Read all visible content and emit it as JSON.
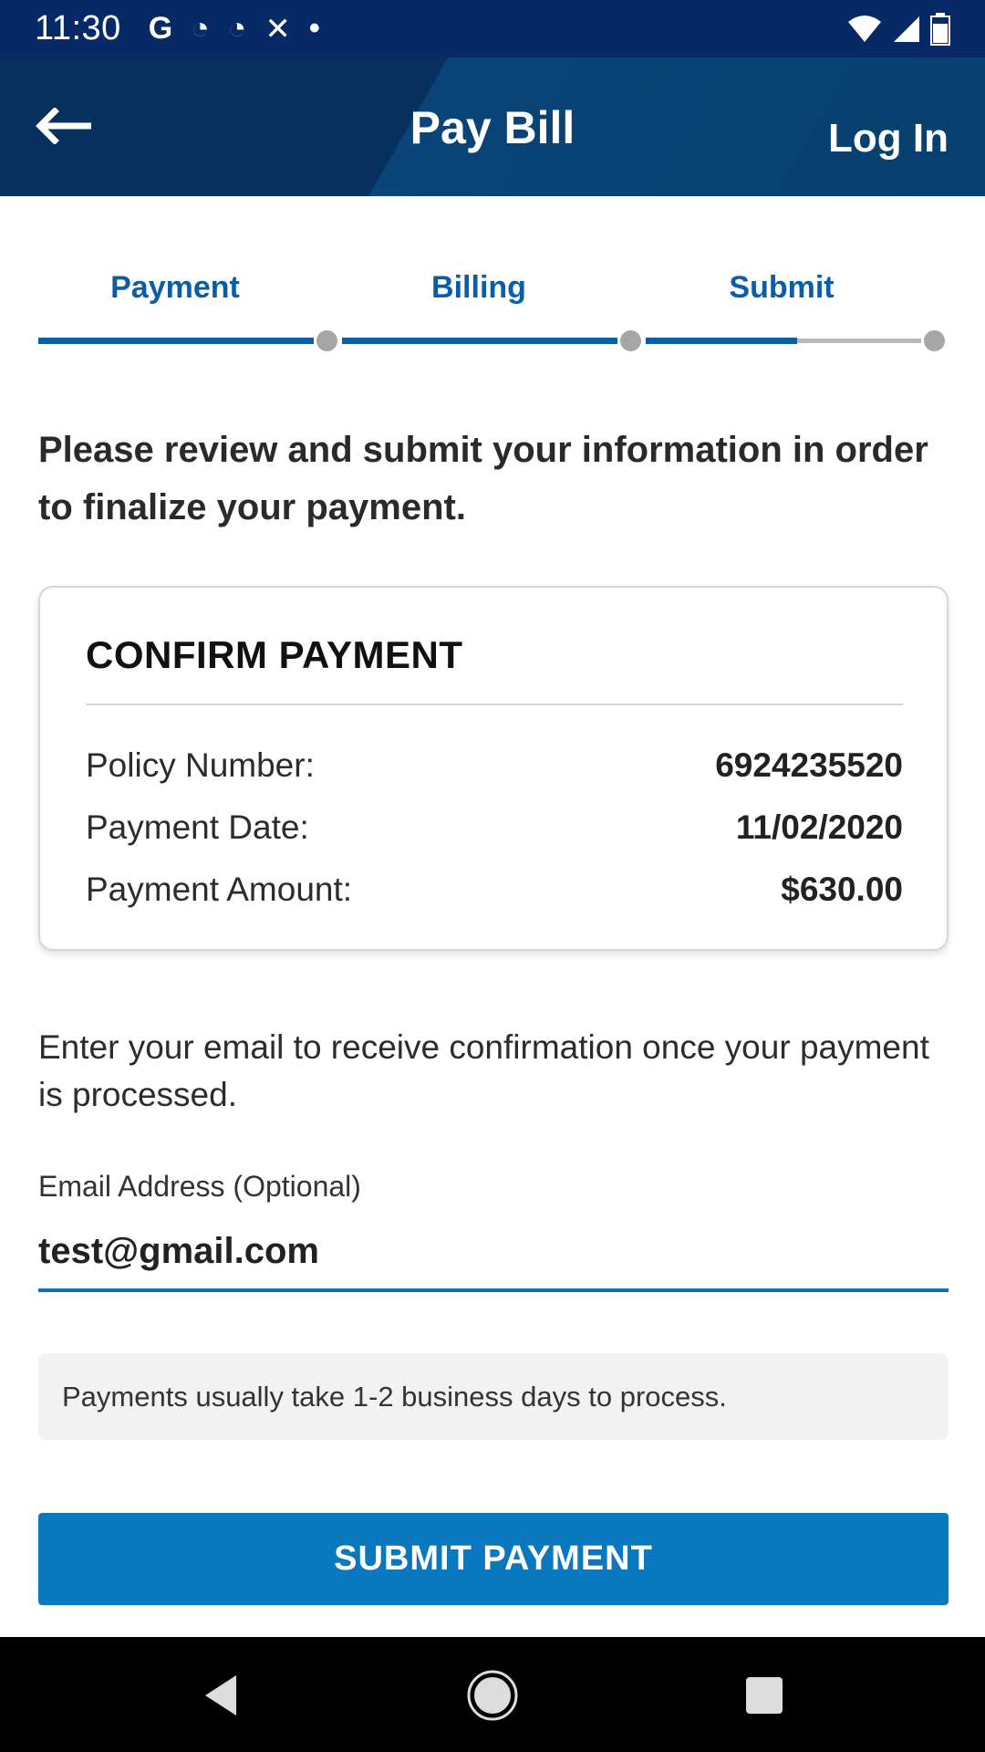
{
  "status_bar": {
    "time": "11:30",
    "left_icons": [
      "google-icon",
      "cast-icon",
      "cast-icon",
      "missed-call-icon",
      "dot-icon"
    ],
    "left_glyphs": [
      "G",
      "◔",
      "◔",
      "✕",
      "•"
    ],
    "right_icons": [
      "wifi-icon",
      "signal-icon",
      "battery-icon"
    ]
  },
  "header": {
    "title": "Pay Bill",
    "login_label": "Log In",
    "back_icon": "arrow-left-icon"
  },
  "steps": {
    "items": [
      {
        "label": "Payment"
      },
      {
        "label": "Billing"
      },
      {
        "label": "Submit"
      }
    ],
    "progress_in_last_step": 0.55
  },
  "intro_text": "Please review and submit your information in order to finalize your payment.",
  "confirm_card": {
    "title": "CONFIRM PAYMENT",
    "rows": [
      {
        "label": "Policy Number:",
        "value": "6924235520"
      },
      {
        "label": "Payment Date:",
        "value": "11/02/2020"
      },
      {
        "label": "Payment Amount:",
        "value": "$630.00"
      }
    ]
  },
  "email": {
    "hint": "Enter your email to receive confirmation once your payment is processed.",
    "label": "Email Address (Optional)",
    "value": "test@gmail.com"
  },
  "note": "Payments usually take 1-2 business days to process.",
  "submit_label": "SUBMIT PAYMENT",
  "colors": {
    "header_bg": "#06305e",
    "accent": "#0a78bf",
    "step_active": "#0a5ea8"
  },
  "nav_bar": {
    "icons": [
      "back-triangle-icon",
      "home-circle-icon",
      "recents-square-icon"
    ]
  }
}
